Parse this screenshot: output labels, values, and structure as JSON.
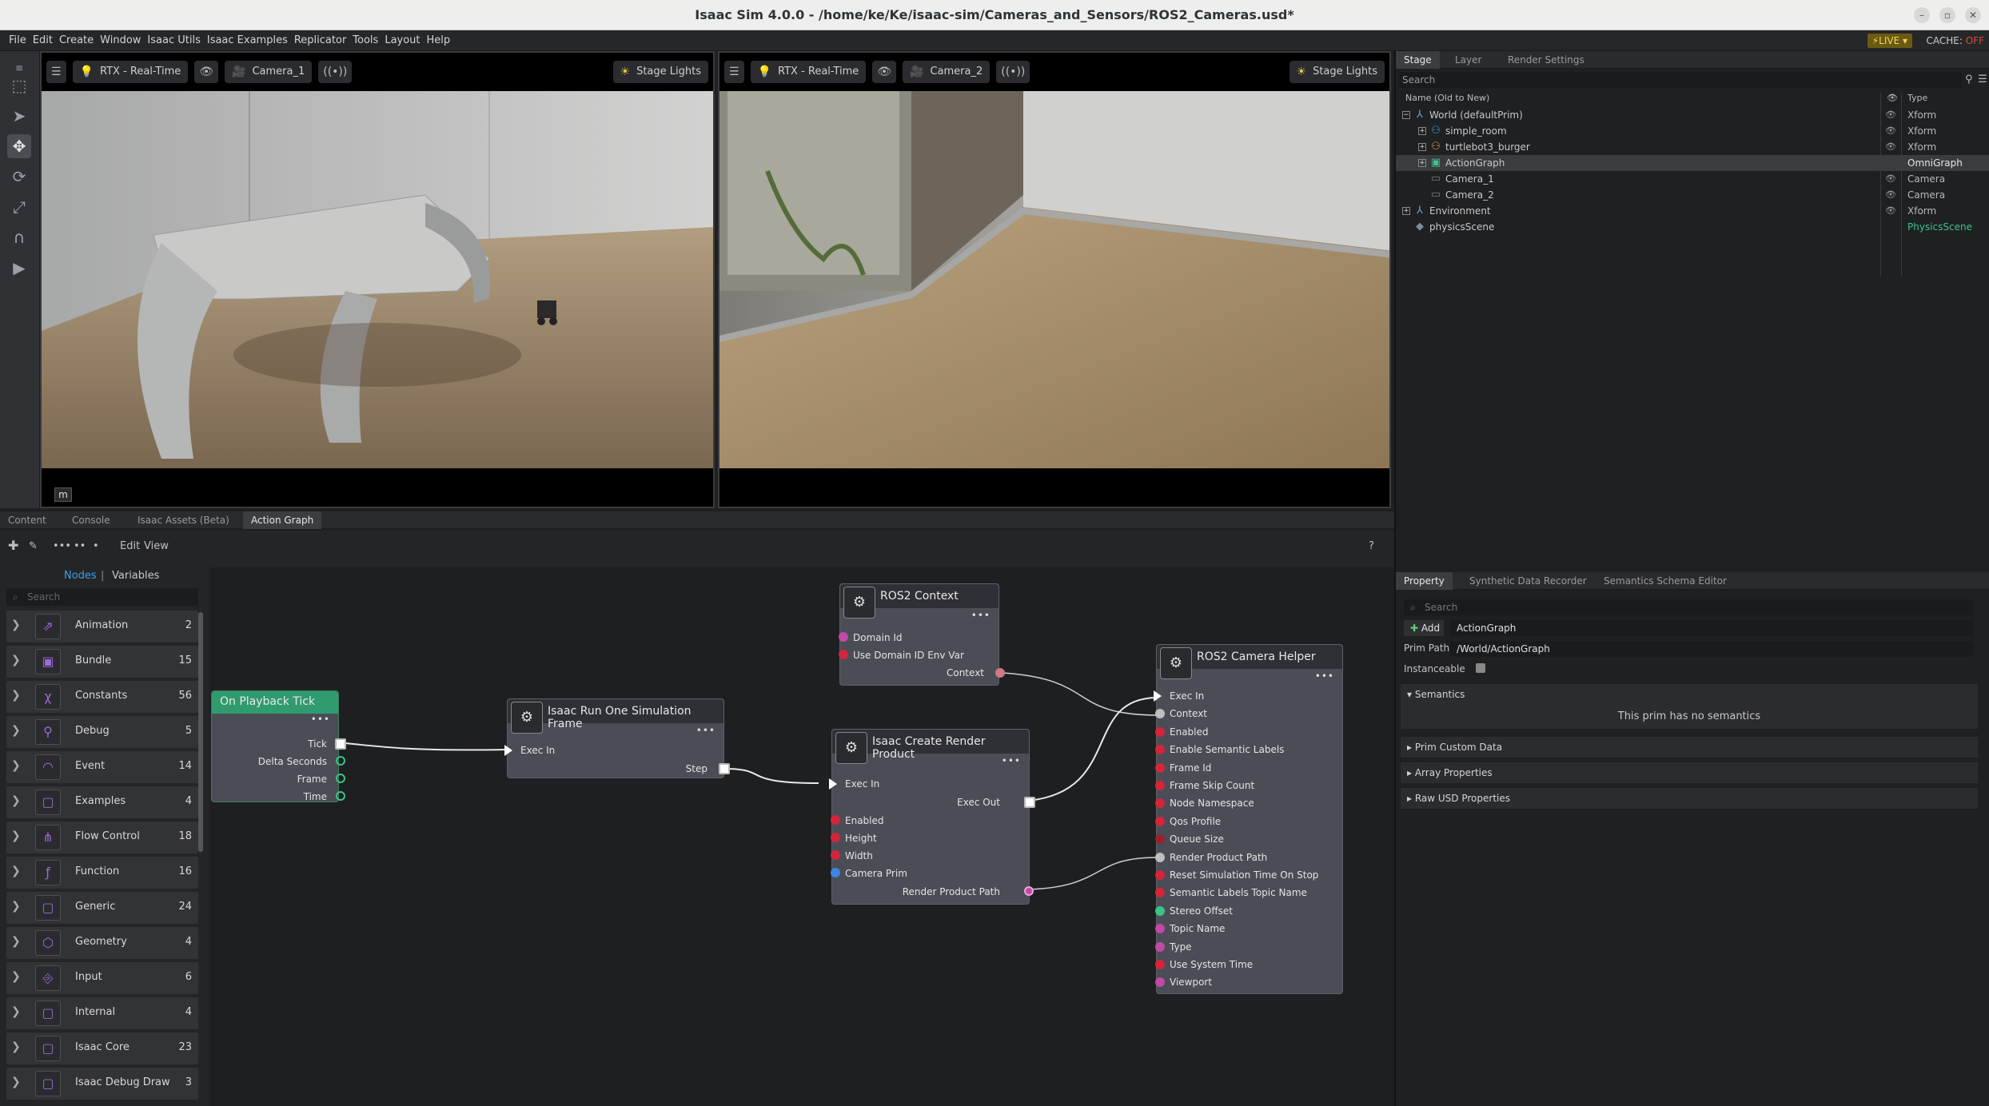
{
  "window": {
    "title": "Isaac Sim 4.0.0 - /home/ke/Ke/isaac-sim/Cameras_and_Sensors/ROS2_Cameras.usd*"
  },
  "menu": [
    "File",
    "Edit",
    "Create",
    "Window",
    "Isaac Utils",
    "Isaac Examples",
    "Replicator",
    "Tools",
    "Layout",
    "Help"
  ],
  "status": {
    "live": "LIVE",
    "cache_label": "CACHE:",
    "cache_value": "OFF"
  },
  "viewport1": {
    "render_mode": "RTX - Real-Time",
    "camera": "Camera_1",
    "lights": "Stage Lights",
    "m_button": "m"
  },
  "viewport2": {
    "render_mode": "RTX - Real-Time",
    "camera": "Camera_2",
    "lights": "Stage Lights"
  },
  "bottom_tabs": [
    "Content",
    "Console",
    "Isaac Assets (Beta)",
    "Action Graph"
  ],
  "graph_toolbar": {
    "edit": "Edit",
    "view": "View",
    "help": "?"
  },
  "node_library": {
    "tab_nodes": "Nodes",
    "separator": "|",
    "tab_variables": "Variables",
    "search_placeholder": "Search",
    "categories": [
      {
        "name": "Animation",
        "count": "2",
        "icon": "animation-icon"
      },
      {
        "name": "Bundle",
        "count": "15",
        "icon": "bundle-icon"
      },
      {
        "name": "Constants",
        "count": "56",
        "icon": "constants-icon"
      },
      {
        "name": "Debug",
        "count": "5",
        "icon": "debug-icon"
      },
      {
        "name": "Event",
        "count": "14",
        "icon": "event-icon"
      },
      {
        "name": "Examples",
        "count": "4",
        "icon": "examples-icon"
      },
      {
        "name": "Flow Control",
        "count": "18",
        "icon": "flow-control-icon"
      },
      {
        "name": "Function",
        "count": "16",
        "icon": "function-icon"
      },
      {
        "name": "Generic",
        "count": "24",
        "icon": "generic-icon"
      },
      {
        "name": "Geometry",
        "count": "4",
        "icon": "geometry-icon"
      },
      {
        "name": "Input",
        "count": "6",
        "icon": "input-icon"
      },
      {
        "name": "Internal",
        "count": "4",
        "icon": "internal-icon"
      },
      {
        "name": "Isaac Core",
        "count": "23",
        "icon": "isaac-core-icon"
      },
      {
        "name": "Isaac Debug Draw",
        "count": "3",
        "icon": "isaac-debug-draw-icon"
      }
    ]
  },
  "graph": {
    "on_playback_tick": {
      "title": "On Playback Tick",
      "ports": [
        "Tick",
        "Delta Seconds",
        "Frame",
        "Time"
      ]
    },
    "run_one_frame": {
      "title": "Isaac Run One Simulation Frame",
      "in": "Exec In",
      "out": "Step"
    },
    "ros2_context": {
      "title": "ROS2 Context",
      "ports": [
        "Domain Id",
        "Use Domain ID Env Var"
      ],
      "out": "Context"
    },
    "render_product": {
      "title": "Isaac Create Render Product",
      "in": "Exec In",
      "out": "Exec Out",
      "ports": [
        "Enabled",
        "Height",
        "Width",
        "Camera Prim"
      ],
      "out2": "Render Product Path"
    },
    "camera_helper": {
      "title": "ROS2 Camera Helper",
      "ports": [
        "Exec In",
        "Context",
        "Enabled",
        "Enable Semantic Labels",
        "Frame Id",
        "Frame Skip Count",
        "Node Namespace",
        "Qos Profile",
        "Queue Size",
        "Render Product Path",
        "Reset Simulation Time On Stop",
        "Semantic Labels Topic Name",
        "Stereo Offset",
        "Topic Name",
        "Type",
        "Use System Time",
        "Viewport"
      ]
    },
    "menu_dots": "•••"
  },
  "stage": {
    "tabs": [
      "Stage",
      "Layer",
      "Render Settings"
    ],
    "search_placeholder": "Search",
    "col_name": "Name (Old to New)",
    "col_type": "Type",
    "rows": [
      {
        "name": "World (defaultPrim)",
        "type": "Xform"
      },
      {
        "name": "simple_room",
        "type": "Xform"
      },
      {
        "name": "turtlebot3_burger",
        "type": "Xform"
      },
      {
        "name": "ActionGraph",
        "type": "OmniGraph"
      },
      {
        "name": "Camera_1",
        "type": "Camera"
      },
      {
        "name": "Camera_2",
        "type": "Camera"
      },
      {
        "name": "Environment",
        "type": "Xform"
      },
      {
        "name": "physicsScene",
        "type": "PhysicsScene"
      }
    ]
  },
  "property": {
    "tabs": [
      "Property",
      "Synthetic Data Recorder",
      "Semantics Schema Editor"
    ],
    "search_placeholder": "Search",
    "add_label": "Add",
    "prim_name": "ActionGraph",
    "prim_path_label": "Prim Path",
    "prim_path": "/World/ActionGraph",
    "instanceable_label": "Instanceable",
    "semantics_label": "Semantics",
    "semantics_empty": "This prim has no semantics",
    "sections": [
      "Prim Custom Data",
      "Array Properties",
      "Raw USD Properties"
    ]
  },
  "colors": {
    "accent": "#2f9b6e",
    "selection": "#3a3c40",
    "live": "#f4d84a",
    "off": "#d94a3a"
  }
}
